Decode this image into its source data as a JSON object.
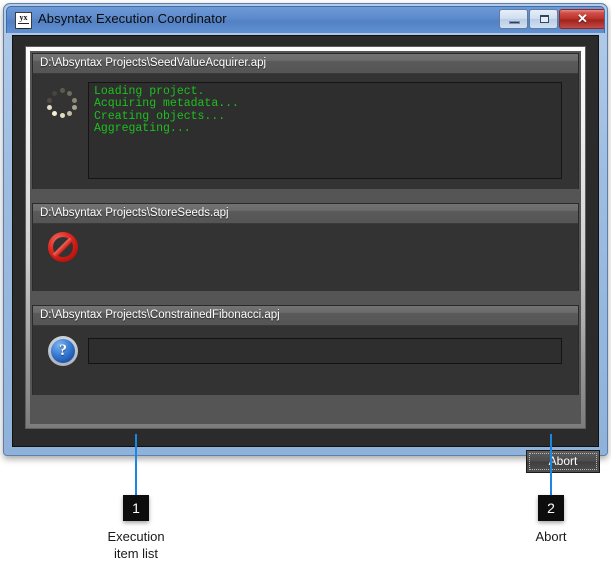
{
  "window": {
    "title": "Absyntax Execution Coordinator",
    "icon": "app-icon",
    "controls": {
      "minimize": "minimize-icon",
      "maximize": "maximize-icon",
      "close": "✕"
    }
  },
  "execution_items": [
    {
      "header": "D:\\Absyntax Projects\\SeedValueAcquirer.apj",
      "status_icon": "spinner-icon",
      "console_text": "Loading project.\nAcquiring metadata...\nCreating objects...\nAggregating..."
    },
    {
      "header": "D:\\Absyntax Projects\\StoreSeeds.apj",
      "status_icon": "no-entry-icon",
      "console_text": ""
    },
    {
      "header": "D:\\Absyntax Projects\\ConstrainedFibonacci.apj",
      "status_icon": "help-icon",
      "input_value": "",
      "input_placeholder": ""
    }
  ],
  "buttons": {
    "abort": "Abort"
  },
  "callouts": [
    {
      "number": "1",
      "label": "Execution\nitem list",
      "label_line1": "Execution",
      "label_line2": "item list"
    },
    {
      "number": "2",
      "label": "Abort",
      "label_line1": "Abort",
      "label_line2": ""
    }
  ],
  "colors": {
    "titlebar": "#5c89cb",
    "console_text": "#1dc01d",
    "callout_line": "#1b87e0",
    "close_button": "#b92f28"
  }
}
